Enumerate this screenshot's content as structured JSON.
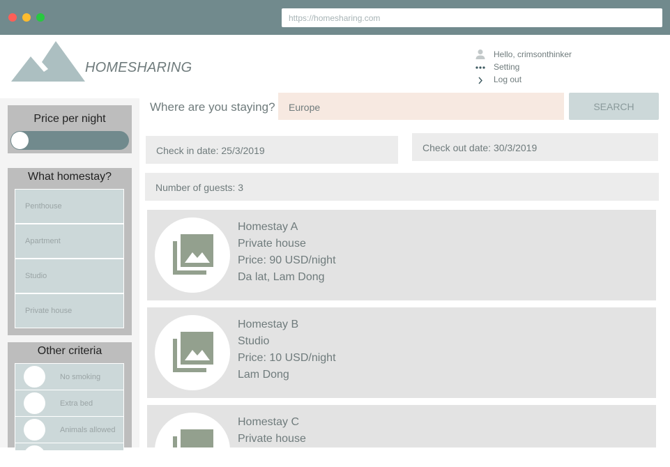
{
  "browser": {
    "url": "https://homesharing.com"
  },
  "header": {
    "brand": "HOMESHARING"
  },
  "user_menu": [
    {
      "icon": "user-icon",
      "label": "Hello, crimsonthinker"
    },
    {
      "icon": "more-dots-icon",
      "label": "Setting"
    },
    {
      "icon": "chevron-right-icon",
      "label": "Log out"
    }
  ],
  "sidebar": {
    "price": {
      "title": "Price per night",
      "level": 0
    },
    "homestay": {
      "title": "What homestay?",
      "options": [
        "Penthouse",
        "Apartment",
        "Studio",
        "Private house"
      ]
    },
    "criteria": {
      "title": "Other criteria",
      "options": [
        "No smoking",
        "Extra bed",
        "Animals allowed"
      ]
    }
  },
  "search": {
    "question": "Where are you staying?",
    "value": "Europe",
    "button": "SEARCH"
  },
  "filters": {
    "check_in": "Check in date: 25/3/2019",
    "check_out": "Check out date: 30/3/2019",
    "guests": "Number of guests: 3"
  },
  "listings": [
    {
      "name": "Homestay A",
      "type": "Private house",
      "price": "Price: 90 USD/night",
      "location": "Da lat, Lam Dong"
    },
    {
      "name": "Homestay B",
      "type": "Studio",
      "price": "Price: 10 USD/night",
      "location": "Lam Dong"
    },
    {
      "name": "Homestay C",
      "type": "Private house",
      "price": "",
      "location": ""
    }
  ],
  "colors": {
    "chrome": "#718a8d",
    "panel": "#bdbdbd",
    "cell": "#ccd8d9",
    "input": "#f7e9e1"
  }
}
